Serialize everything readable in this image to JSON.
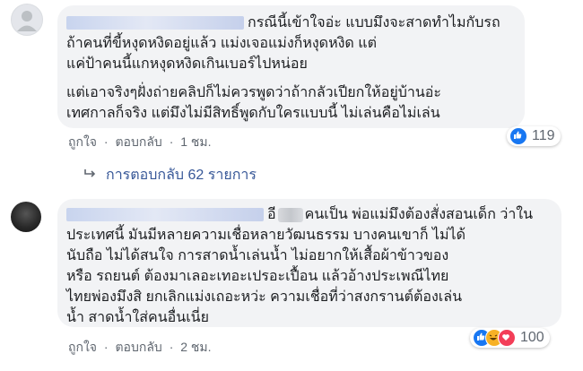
{
  "comments": [
    {
      "lines_p1": [
        "กรณีนี้เข้าใจอ่ะ แบบมึงจะสาดทำไมกับรถ",
        "ถ้าคนที่ขี้หงุดหงิดอยู่แล้ว แม่งเจอแม่งก็หงุดหงิด แต่",
        "แค่ป้าคนนี้แกหงุดหงิดเกินเบอร์ไปหน่อย"
      ],
      "lines_p2": [
        "แต่เอาจริงๆฝั่งถ่ายคลิปก็ไม่ควรพูดว่าถ้ากลัวเปียกให้อยู่บ้านอ่ะ",
        "เทศกาลก็จริง แต่มึงไม่มีสิทธิ์พูดกับใครแบบนี้ ไม่เล่นคือไม่เล่น"
      ],
      "actions": {
        "like": "ถูกใจ",
        "reply": "ตอบกลับ",
        "time": "1 ชม."
      },
      "reaction_count": "119",
      "replies_link": "การตอบกลับ 62 รายการ"
    },
    {
      "first_prefix": "อี",
      "first_suffix": "คนเป็น พ่อแม่มึงต้องสั่งสอนเด็ก ว่าใน",
      "lines": [
        "ประเทศนี้ มันมีหลายความเชื่อหลายวัฒนธรรม บางคนเขาก็ ไม่ได้",
        "นับถือ ไม่ได้สนใจ การสาดน้ำเล่นน้ำ ไม่อยากให้เสื้อผ้าข้าวของ",
        "หรือ รถยนต์ ต้องมาเลอะเทอะเปรอะเปื้อน แล้วอ้างประเพณีไทย",
        "ไทยพ่องมึงสิ ยกเลิกแม่งเถอะหว่ะ ความเชื่อที่ว่าสงกรานต์ต้องเล่น",
        "น้ำ สาดน้ำใส่คนอื่นเนี่ย"
      ],
      "actions": {
        "like": "ถูกใจ",
        "reply": "ตอบกลับ",
        "time": "2 ชม."
      },
      "reaction_count": "100"
    }
  ],
  "colors": {
    "like": "#1877f2",
    "haha": "#f7b125",
    "love": "#f33e58",
    "link": "#385898"
  },
  "icons": [
    "reply-arrow-icon",
    "like-reaction-icon",
    "haha-reaction-icon",
    "love-reaction-icon"
  ]
}
